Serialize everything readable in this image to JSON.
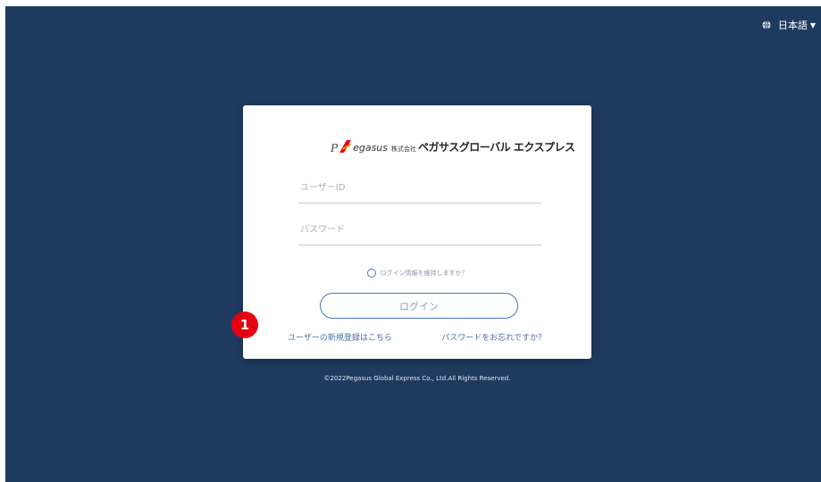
{
  "header": {
    "language_label": "日本語",
    "language_caret": "▼"
  },
  "logo": {
    "prefix": "P",
    "brand": "egasus",
    "corp": "株式会社",
    "company": "ペガサスグローバル エクスプレス"
  },
  "form": {
    "userid_placeholder": "ユーザーID",
    "password_placeholder": "パスワード",
    "remember_label": "ログイン情報を維持しますか？",
    "login_button": "ログイン",
    "register_link": "ユーザーの新規登録はこちら",
    "forgot_link": "パスワードをお忘れですか？"
  },
  "footer": {
    "copyright": "©2022Pegasus Global Express Co., Ltd.All Rights Reserved."
  },
  "annotation": {
    "badge_number": "1"
  },
  "colors": {
    "background": "#1f3a5f",
    "accent": "#4a78b5",
    "badge": "#e60012",
    "logo_red": "#e60012"
  },
  "icons": [
    "globe-icon",
    "caret-down-icon",
    "pegasus-logo-icon"
  ]
}
